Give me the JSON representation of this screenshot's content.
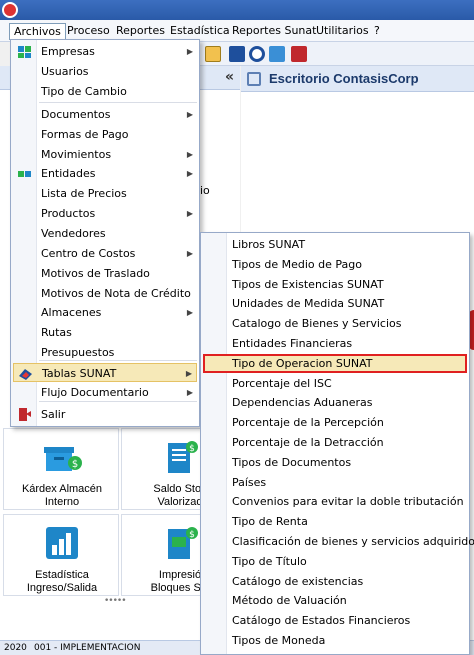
{
  "menubar": [
    "Archivos",
    "Proceso",
    "Reportes",
    "Estadística",
    "Reportes Sunat",
    "Utilitarios",
    "?"
  ],
  "left_panel": {
    "collapse_glyph": "«",
    "truncated_text": "io"
  },
  "desktop": {
    "title": "Escritorio ContasisCorp"
  },
  "archivos_menu": [
    {
      "label": "Empresas",
      "submenu": true,
      "icon": "buildings-icon"
    },
    {
      "label": "Usuarios",
      "submenu": false,
      "icon": null
    },
    {
      "label": "Tipo de Cambio",
      "submenu": false,
      "icon": null
    },
    {
      "label": "Documentos",
      "submenu": true,
      "icon": null
    },
    {
      "label": "Formas de Pago",
      "submenu": false,
      "icon": null
    },
    {
      "label": "Movimientos",
      "submenu": true,
      "icon": null
    },
    {
      "label": "Entidades",
      "submenu": true,
      "icon": "entities-icon"
    },
    {
      "label": "Lista de Precios",
      "submenu": false,
      "icon": null
    },
    {
      "label": "Productos",
      "submenu": true,
      "icon": null
    },
    {
      "label": "Vendedores",
      "submenu": false,
      "icon": null
    },
    {
      "label": "Centro de Costos",
      "submenu": true,
      "icon": null
    },
    {
      "label": "Motivos de Traslado",
      "submenu": false,
      "icon": null
    },
    {
      "label": "Motivos de Nota de Crédito",
      "submenu": false,
      "icon": null
    },
    {
      "label": "Almacenes",
      "submenu": true,
      "icon": null
    },
    {
      "label": "Rutas",
      "submenu": false,
      "icon": null
    },
    {
      "label": "Presupuestos",
      "submenu": false,
      "icon": null
    },
    {
      "label": "Tablas SUNAT",
      "submenu": true,
      "icon": "sunat-icon",
      "highlighted": true
    },
    {
      "label": "Flujo Documentario",
      "submenu": true,
      "icon": null
    },
    {
      "label": "Salir",
      "submenu": false,
      "icon": "exit-icon"
    }
  ],
  "tablas_sunat_menu": [
    "Libros SUNAT",
    "Tipos de Medio de Pago",
    "Tipos de Existencias SUNAT",
    "Unidades de Medida SUNAT",
    "Catalogo de Bienes y Servicios",
    "Entidades Financieras",
    "Tipo de Operacion SUNAT",
    "Porcentaje del ISC",
    "Dependencias Aduaneras",
    "Porcentaje de la Percepción",
    "Porcentaje de la Detracción",
    "Tipos de Documentos",
    "Países",
    "Convenios para evitar la doble tributación",
    "Tipo de Renta",
    "Clasificación de bienes y servicios adquiridos",
    "Tipo de Título",
    "Catálogo de existencias",
    "Método de Valuación",
    "Catálogo de Estados Financieros",
    "Tipos de Moneda"
  ],
  "selected_submenu_index": 6,
  "tiles": [
    {
      "label_line1": "Kárdex Almacén",
      "label_line2": "Interno"
    },
    {
      "label_line1": "Saldo Stoc",
      "label_line2": "Valorizad"
    },
    {
      "label_line1": "Estadística",
      "label_line2": "Ingreso/Salida"
    },
    {
      "label_line1": "Impresió",
      "label_line2": "Bloques Sal"
    }
  ],
  "grip": "•••••",
  "status": {
    "year": "2020",
    "company": "001 - IMPLEMENTACION"
  },
  "colors": {
    "highlight_fill": "#f6e9b8",
    "selection_border": "#e02020",
    "accent_blue": "#1c3a6b"
  }
}
